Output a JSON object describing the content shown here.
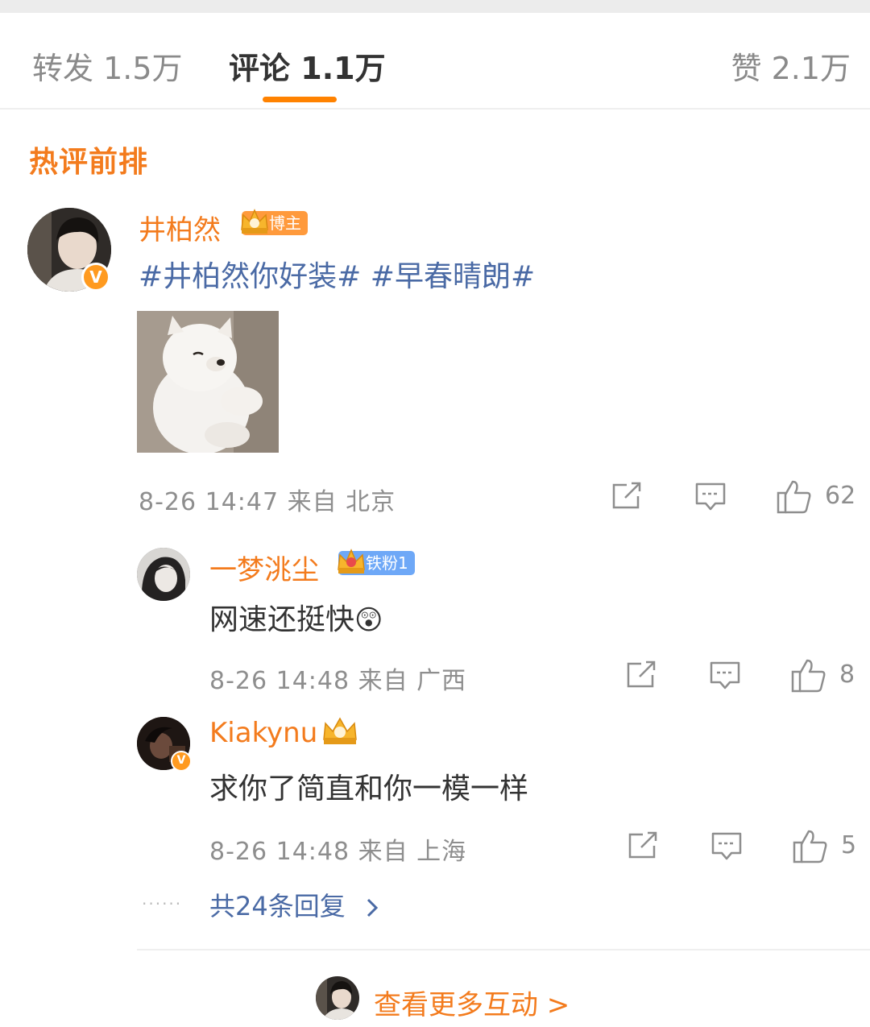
{
  "tabs": [
    {
      "label": "转发",
      "count": "1.5万"
    },
    {
      "label": "评论",
      "count": "1.1万"
    },
    {
      "label": "赞",
      "count": "2.1万"
    }
  ],
  "section_title": "热评前排",
  "main_comment": {
    "username": "井柏然",
    "badge_label": "博主",
    "badge_level": "10",
    "text_part1": "#井柏然你好装#",
    "text_part2": "#早春晴朗#",
    "timestamp": "8-26 14:47",
    "source": "来自 北京",
    "likes": "62"
  },
  "replies": [
    {
      "username": "一梦洮尘",
      "badge_label": "铁粉1",
      "badge_level": "5",
      "text": "网速还挺快",
      "emoji": "😲",
      "timestamp": "8-26 14:48",
      "source": "来自 广西",
      "likes": "8"
    },
    {
      "username": "Kiakynu",
      "badge_level": "8",
      "text": "求你了简直和你一模一样",
      "timestamp": "8-26 14:48",
      "source": "来自 上海",
      "likes": "5"
    }
  ],
  "dots": "......",
  "more_replies_label": "共24条回复",
  "more_interactions_label": "查看更多互动 >",
  "colors": {
    "accent_orange": "#ff8200",
    "username_orange": "#f37b1d",
    "link_blue": "#4a6aa5",
    "fan_badge_blue": "#6ea8f7",
    "muted_gray": "#8e8e8e"
  },
  "icons": [
    "share-icon",
    "reply-icon",
    "thumbs-up-icon",
    "verified-v-icon",
    "crown-icon",
    "chevron-right-icon"
  ]
}
